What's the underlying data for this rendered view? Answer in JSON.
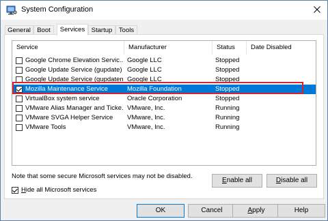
{
  "window": {
    "title": "System Configuration"
  },
  "tabs": [
    "General",
    "Boot",
    "Services",
    "Startup",
    "Tools"
  ],
  "active_tab": "Services",
  "columns": [
    "Service",
    "Manufacturer",
    "Status",
    "Date Disabled"
  ],
  "rows": [
    {
      "service": "Google Chrome Elevation Servic...",
      "manufacturer": "Google LLC",
      "status": "Stopped",
      "date_disabled": "",
      "checked": false,
      "selected": false
    },
    {
      "service": "Google Update Service (gupdate)",
      "manufacturer": "Google LLC",
      "status": "Stopped",
      "date_disabled": "",
      "checked": false,
      "selected": false
    },
    {
      "service": "Google Update Service (gupdatem)",
      "manufacturer": "Google LLC",
      "status": "Stopped",
      "date_disabled": "",
      "checked": false,
      "selected": false
    },
    {
      "service": "Mozilla Maintenance Service",
      "manufacturer": "Mozilla Foundation",
      "status": "Stopped",
      "date_disabled": "",
      "checked": true,
      "selected": true
    },
    {
      "service": "VirtualBox system service",
      "manufacturer": "Oracle Corporation",
      "status": "Stopped",
      "date_disabled": "",
      "checked": false,
      "selected": false
    },
    {
      "service": "VMware Alias Manager and Ticke...",
      "manufacturer": "VMware, Inc.",
      "status": "Running",
      "date_disabled": "",
      "checked": false,
      "selected": false
    },
    {
      "service": "VMware SVGA Helper Service",
      "manufacturer": "VMware, Inc.",
      "status": "Running",
      "date_disabled": "",
      "checked": false,
      "selected": false
    },
    {
      "service": "VMware Tools",
      "manufacturer": "VMware, Inc.",
      "status": "Running",
      "date_disabled": "",
      "checked": false,
      "selected": false
    }
  ],
  "note": "Note that some secure Microsoft services may not be disabled.",
  "buttons": {
    "enable_all": {
      "accel": "E",
      "rest": "nable all"
    },
    "disable_all": {
      "accel": "D",
      "rest": "isable all"
    },
    "ok": "OK",
    "cancel": "Cancel",
    "apply": {
      "accel": "A",
      "rest": "pply"
    },
    "help": "Help"
  },
  "hide_ms": {
    "accel": "H",
    "rest": "ide all Microsoft services",
    "checked": true
  },
  "colors": {
    "selection": "#0078d7",
    "highlight_outline": "#d9222a",
    "window_bg": "#f0f0f0"
  }
}
